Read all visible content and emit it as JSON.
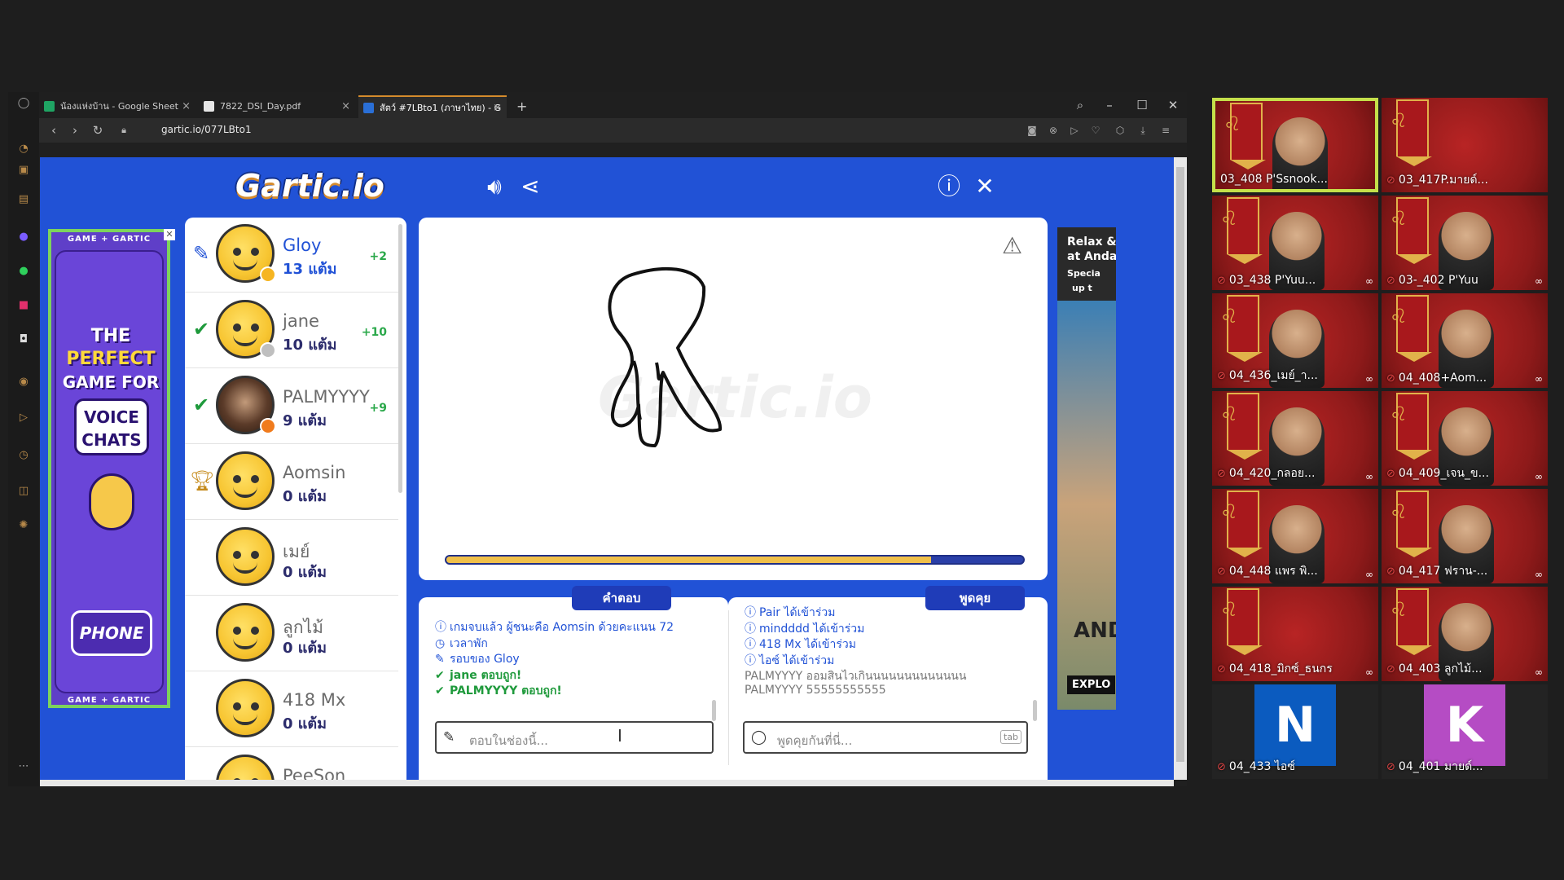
{
  "browser": {
    "tabs": [
      {
        "title": "น้องแห่งบ้าน - Google Sheet",
        "favicon_color": "#1fa463"
      },
      {
        "title": "7822_DSI_Day.pdf",
        "favicon_color": "#e6e6e6"
      },
      {
        "title": "สัตว์ #7LBto1 (ภาษาไทย) - G",
        "favicon_color": "#2a6fd6"
      }
    ],
    "new_tab": "+",
    "url": "gartic.io/077LBto1"
  },
  "game": {
    "logo": "Gartic.io",
    "players": [
      {
        "name": "Gloy",
        "score": "13 แต้ม",
        "gain": "+2",
        "mark": "pencil",
        "dot": "#f6b521",
        "active": true
      },
      {
        "name": "jane",
        "score": "10 แต้ม",
        "gain": "+10",
        "mark": "check",
        "dot": "#bfbfbf"
      },
      {
        "name": "PALMYYYY",
        "score": "9 แต้ม",
        "gain": "+9",
        "mark": "check",
        "dot": "#f07b1d",
        "photo": true
      },
      {
        "name": "Aomsin",
        "score": "0 แต้ม",
        "gain": "",
        "mark": "trophy"
      },
      {
        "name": "เมย์",
        "score": "0 แต้ม",
        "gain": "",
        "mark": ""
      },
      {
        "name": "ลูกไม้",
        "score": "0 แต้ม",
        "gain": "",
        "mark": ""
      },
      {
        "name": "418 Mx",
        "score": "0 แต้ม",
        "gain": "",
        "mark": ""
      },
      {
        "name": "PeeSon",
        "score": "",
        "gain": "",
        "mark": ""
      }
    ],
    "timer_progress": 0.84,
    "answers": {
      "tab": "คำตอบ",
      "messages": [
        {
          "type": "info",
          "icon": "info",
          "text": "เกมจบแล้ว ผู้ชนะคือ Aomsin ด้วยคะแนน 72"
        },
        {
          "type": "info",
          "icon": "clock",
          "text": "เวลาพัก"
        },
        {
          "type": "info",
          "icon": "pencil",
          "text": "รอบของ Gloy"
        },
        {
          "type": "ok",
          "icon": "check",
          "text": "jane ตอบถูก!"
        },
        {
          "type": "ok",
          "icon": "check",
          "text": "PALMYYYY ตอบถูก!"
        }
      ],
      "placeholder": "ตอบในช่องนี้..."
    },
    "chat": {
      "tab": "พูดคุย",
      "messages": [
        {
          "type": "info",
          "icon": "info",
          "text": "Pair ได้เข้าร่วม"
        },
        {
          "type": "info",
          "icon": "info",
          "text": "mindddd ได้เข้าร่วม"
        },
        {
          "type": "info",
          "icon": "info",
          "text": "418 Mx ได้เข้าร่วม"
        },
        {
          "type": "info",
          "icon": "info",
          "text": "ไอซ์ ได้เข้าร่วม"
        },
        {
          "type": "grey",
          "icon": "",
          "text": "PALMYYYY ออมสินไวเกินนนนนนนนนนนนน"
        },
        {
          "type": "grey",
          "icon": "",
          "text": "PALMYYYY 55555555555"
        }
      ],
      "placeholder": "พูดคุยกันที่นี่...",
      "tab_hint": "tab"
    }
  },
  "ads": {
    "left": {
      "strip": "GAME + GARTIC",
      "lines": [
        "THE",
        "PERFECT",
        "GAME FOR"
      ],
      "voice": [
        "VOICE",
        "CHATS"
      ],
      "phone": "PHONE"
    },
    "right": {
      "lines": [
        "Relax &",
        "at Anda",
        "Specia",
        "up t"
      ],
      "brand": "AND",
      "cta": "EXPLO"
    }
  },
  "meeting": {
    "participants": [
      {
        "name": "03_408 P'Ssnook...",
        "active": true,
        "video": true
      },
      {
        "name": "03_417P.มายด์...",
        "video": false
      },
      {
        "name": "03_438 P'Yuu...",
        "video": true
      },
      {
        "name": "03-_402 P'Yuu",
        "video": true
      },
      {
        "name": "04_436_เมย์_า...",
        "video": true
      },
      {
        "name": "04_408+Aom...",
        "video": true
      },
      {
        "name": "04_420_กลอย...",
        "video": true
      },
      {
        "name": "04_409_เจน_ข...",
        "video": true
      },
      {
        "name": "04_448 แพร พิ...",
        "video": true
      },
      {
        "name": "04_417 ฟราน-...",
        "video": true
      },
      {
        "name": "04_418_มิกซ์_ธนกร",
        "video": false
      },
      {
        "name": "04_403 ลูกไม้...",
        "video": true
      },
      {
        "name": "04_433 ไอซ์",
        "letter": "N",
        "color": "#0b5bbf"
      },
      {
        "name": "04_401 มายด์...",
        "letter": "K",
        "color": "#b54cc4"
      }
    ]
  }
}
